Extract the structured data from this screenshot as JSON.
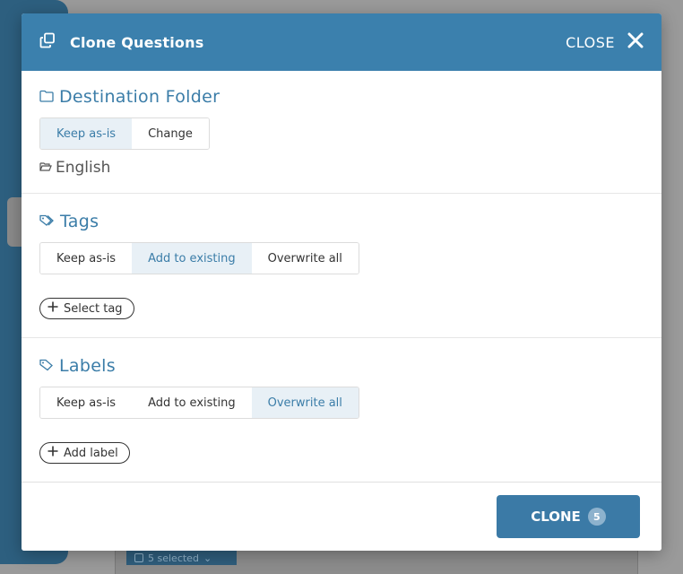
{
  "background": {
    "selected_count_label": "5 selected"
  },
  "modal": {
    "title": "Clone Questions",
    "close_label": "CLOSE",
    "sections": {
      "destination": {
        "title": "Destination Folder",
        "options": [
          "Keep as-is",
          "Change"
        ],
        "selected_option": "Keep as-is",
        "folder_name": "English"
      },
      "tags": {
        "title": "Tags",
        "options": [
          "Keep as-is",
          "Add to existing",
          "Overwrite all"
        ],
        "selected_option": "Add to existing",
        "action_label": "Select tag"
      },
      "labels": {
        "title": "Labels",
        "options": [
          "Keep as-is",
          "Add to existing",
          "Overwrite all"
        ],
        "selected_option": "Overwrite all",
        "action_label": "Add label"
      }
    },
    "footer": {
      "clone_label": "CLONE",
      "clone_count": "5"
    }
  },
  "colors": {
    "header": "#3b80ad",
    "accent": "#3b7da8",
    "selected_segment": "#e8f0f6",
    "clone_button": "#3b7aa6"
  }
}
